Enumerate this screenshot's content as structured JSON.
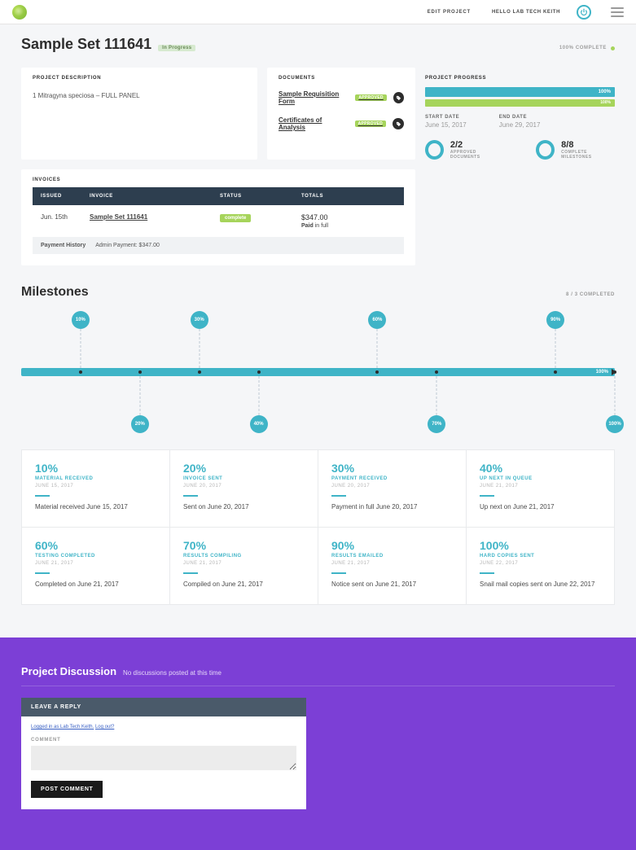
{
  "header": {
    "edit_label": "EDIT PROJECT",
    "hello_label": "HELLO LAB TECH KEITH"
  },
  "title": {
    "heading": "Sample Set 111641",
    "status_badge": "In Progress",
    "complete_label": "100% COMPLETE"
  },
  "description": {
    "header": "PROJECT DESCRIPTION",
    "body": "1 Mitragyna speciosa – FULL PANEL"
  },
  "documents": {
    "header": "DOCUMENTS",
    "items": [
      {
        "name": "Sample Requisition Form",
        "status": "APPROVED"
      },
      {
        "name": "Certificates of Analysis",
        "status": "APPROVED"
      }
    ]
  },
  "progress": {
    "header": "PROJECT PROGRESS",
    "bar1_pct": "100%",
    "bar2_pct": "100%",
    "start_label": "START DATE",
    "start_value": "June 15, 2017",
    "end_label": "END DATE",
    "end_value": "June 29, 2017",
    "docs_stat": "2/2",
    "docs_label": "APPROVED DOCUMENTS",
    "ms_stat": "8/8",
    "ms_label": "COMPLETE MILESTONES"
  },
  "invoices": {
    "header": "INVOICES",
    "cols": {
      "issued": "ISSUED",
      "invoice": "INVOICE",
      "status": "STATUS",
      "totals": "TOTALS"
    },
    "rows": [
      {
        "issued": "Jun. 15th",
        "invoice": "Sample Set 111641",
        "status": "complete",
        "amount": "$347.00",
        "paid_b": "Paid",
        "paid_rest": " in full"
      }
    ],
    "payment_history_lbl": "Payment History",
    "payment_history_val": "Admin Payment: $347.00"
  },
  "milestones": {
    "title": "Milestones",
    "completed_label": "8 / 3 COMPLETED",
    "track_pct": "100%",
    "bubbles_top": [
      {
        "pct": "10%",
        "pos": 10
      },
      {
        "pct": "30%",
        "pos": 30
      },
      {
        "pct": "60%",
        "pos": 60
      },
      {
        "pct": "90%",
        "pos": 90
      }
    ],
    "bubbles_bot": [
      {
        "pct": "20%",
        "pos": 20
      },
      {
        "pct": "40%",
        "pos": 40
      },
      {
        "pct": "70%",
        "pos": 70
      },
      {
        "pct": "100%",
        "pos": 100
      }
    ],
    "cards": [
      {
        "pct": "10%",
        "name": "MATERIAL RECEIVED",
        "date": "JUNE 15, 2017",
        "desc": "Material received June 15, 2017"
      },
      {
        "pct": "20%",
        "name": "INVOICE SENT",
        "date": "JUNE 20, 2017",
        "desc": "Sent on June 20, 2017"
      },
      {
        "pct": "30%",
        "name": "PAYMENT RECEIVED",
        "date": "JUNE 20, 2017",
        "desc": "Payment in full June 20, 2017"
      },
      {
        "pct": "40%",
        "name": "UP NEXT IN QUEUE",
        "date": "JUNE 21, 2017",
        "desc": "Up next on June 21, 2017"
      },
      {
        "pct": "60%",
        "name": "TESTING COMPLETED",
        "date": "JUNE 21, 2017",
        "desc": "Completed on June 21, 2017"
      },
      {
        "pct": "70%",
        "name": "RESULTS COMPILING",
        "date": "JUNE 21, 2017",
        "desc": "Compiled on June 21, 2017"
      },
      {
        "pct": "90%",
        "name": "RESULTS EMAILED",
        "date": "JUNE 21, 2017",
        "desc": "Notice sent on June 21, 2017"
      },
      {
        "pct": "100%",
        "name": "HARD COPIES SENT",
        "date": "JUNE 22, 2017",
        "desc": "Snail mail copies sent on June 22, 2017"
      }
    ]
  },
  "discussion": {
    "title": "Project Discussion",
    "subtitle": "No discussions posted at this time",
    "reply_header": "LEAVE A REPLY",
    "login_prefix": "Logged in as Lab Tech Keith.",
    "logout": "Log out?",
    "comment_label": "COMMENT",
    "post_button": "POST COMMENT"
  }
}
